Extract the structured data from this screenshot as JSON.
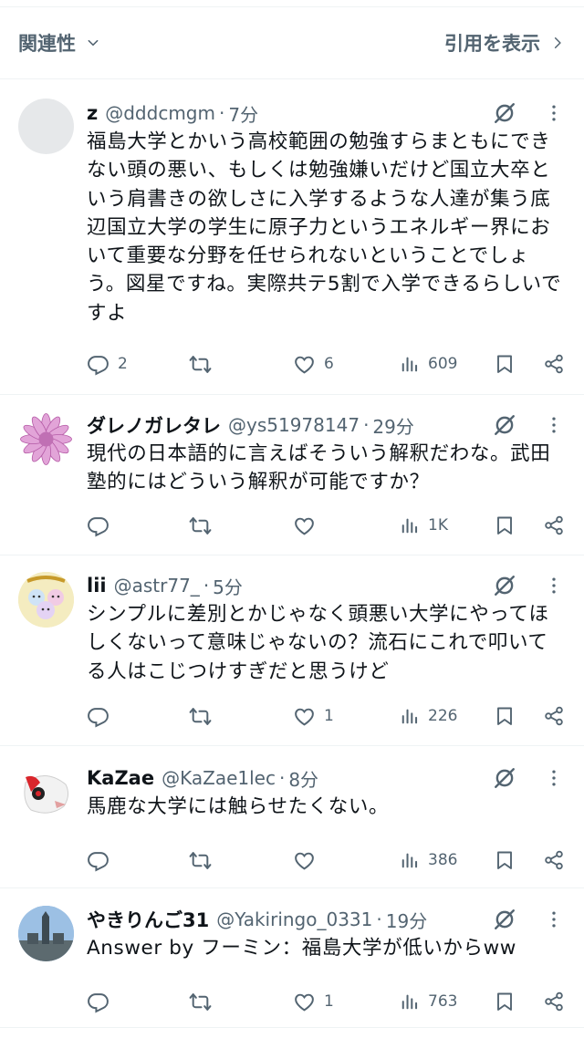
{
  "header": {
    "related_label": "関連性",
    "view_quotes_label": "引用を表示"
  },
  "colors": {
    "icon": "#536471",
    "text": "#0f1419",
    "border": "#eff3f4"
  },
  "tweets": [
    {
      "name": "z",
      "handle": "@dddcmgm",
      "time": "7分",
      "text": "福島大学とかいう高校範囲の勉強すらまともにできない頭の悪い、もしくは勉強嫌いだけど国立大卒という肩書きの欲しさに入学するような人達が集う底辺国立大学の学生に原子力というエネルギー界において重要な分野を任せられないということでしょう。図星ですね。実際共テ5割で入学できるらしいですよ",
      "replies": "2",
      "retweets": "",
      "likes": "6",
      "views": "609",
      "avatar": "blank-gray"
    },
    {
      "name": "ダレノガレタレ",
      "handle": "@ys51978147",
      "time": "29分",
      "text": "現代の日本語的に言えばそういう解釈だわな。武田塾的にはどういう解釈が可能ですか？",
      "replies": "",
      "retweets": "",
      "likes": "",
      "views": "1K",
      "avatar": "pink-flower"
    },
    {
      "name": "lii",
      "handle": "@astr77_",
      "time": "5分",
      "text": "シンプルに差別とかじゃなく頭悪い大学にやってほしくないって意味じゃないの？流石にこれで叩いてる人はこじつけすぎだと思うけど",
      "replies": "",
      "retweets": "",
      "likes": "1",
      "views": "226",
      "avatar": "cartoon-characters"
    },
    {
      "name": "KaZae",
      "handle": "@KaZae1lec",
      "time": "8分",
      "text": "馬鹿な大学には触らせたくない。",
      "replies": "",
      "retweets": "",
      "likes": "",
      "views": "386",
      "avatar": "white-bird"
    },
    {
      "name": "やきりんご31",
      "handle": "@Yakiringo_0331",
      "time": "19分",
      "text": "Answer by フーミン：福島大学が低いからww",
      "replies": "",
      "retweets": "",
      "likes": "1",
      "views": "763",
      "avatar": "building-sky"
    }
  ]
}
